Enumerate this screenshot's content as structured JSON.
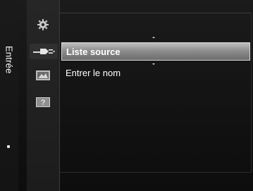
{
  "side_tab": {
    "label": "Entrée"
  },
  "icons": [
    {
      "name": "settings-gear-icon"
    },
    {
      "name": "input-plug-icon",
      "active": true
    },
    {
      "name": "picture-icon"
    },
    {
      "name": "help-icon",
      "glyph": "?"
    }
  ],
  "menu": {
    "items": [
      {
        "label": "Liste source",
        "selected": true
      },
      {
        "label": "Entrer le nom",
        "selected": false
      }
    ]
  },
  "colors": {
    "panel": "#121212",
    "selection": "#9a9a9a",
    "text": "#ffffff"
  }
}
